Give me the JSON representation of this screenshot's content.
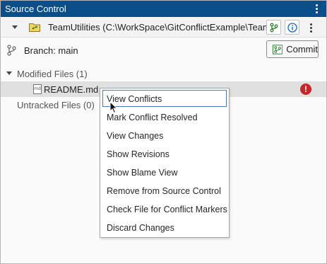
{
  "window": {
    "title": "Source Control"
  },
  "repository": {
    "name": "TeamUtilities (C:\\WorkSpace\\GitConflictExample\\Team..."
  },
  "branch": {
    "label": "Branch: main",
    "commit_label": "Commit"
  },
  "groups": {
    "modified": {
      "label": "Modified Files (1)"
    },
    "untracked": {
      "label": "Untracked Files (0)"
    }
  },
  "files": [
    {
      "icon_text": "md",
      "name": "README.md",
      "status": "conflict",
      "status_glyph": "!"
    }
  ],
  "context_menu": {
    "items": [
      {
        "label": "View Conflicts",
        "highlighted": true
      },
      {
        "label": "Mark Conflict Resolved"
      },
      {
        "label": "View Changes"
      },
      {
        "label": "Show Revisions"
      },
      {
        "label": "Show Blame View"
      },
      {
        "label": "Remove from Source Control"
      },
      {
        "label": "Check File for Conflict Markers"
      },
      {
        "label": "Discard Changes"
      }
    ]
  },
  "colors": {
    "title_bar": "#0b4f8a",
    "selection": "#e0e0e0",
    "conflict": "#c62828",
    "focus": "#4a78c2"
  }
}
